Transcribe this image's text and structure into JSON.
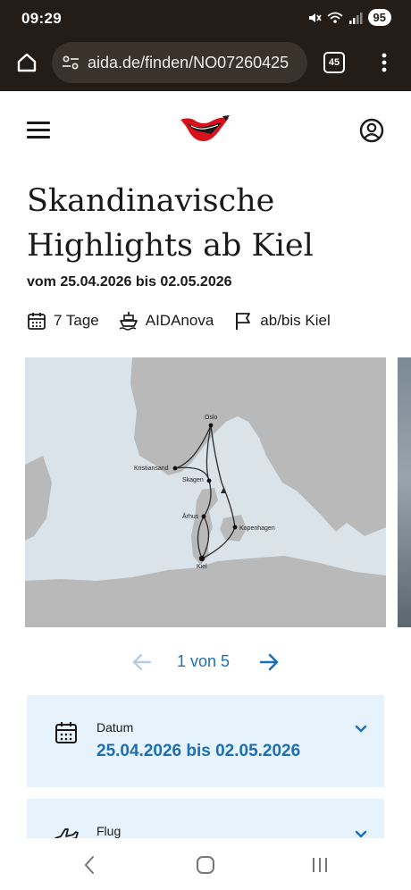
{
  "status_bar": {
    "time": "09:29",
    "battery": "95",
    "icons": [
      "mute-icon",
      "wifi-icon",
      "signal-icon"
    ]
  },
  "browser": {
    "url": "aida.de/finden/NO0726042​5",
    "tab_count": "45",
    "icons": [
      "home-icon",
      "site-settings-icon",
      "tabs-icon",
      "more-vert-icon"
    ]
  },
  "header": {
    "icons": [
      "menu-icon",
      "aida-logo-icon",
      "account-icon"
    ],
    "colors": {
      "logo_red": "#d8121b"
    }
  },
  "trip": {
    "title_line1": "Skandinavische",
    "title_line2": "Highlights ab Kiel",
    "date_range": "vom 25.04.2026 bis 02.05.2026",
    "duration": "7 Tage",
    "ship": "AIDAnova",
    "port": "ab/bis Kiel"
  },
  "map": {
    "ports": [
      "Oslo",
      "Kristiansand",
      "Skagen",
      "Århus",
      "Kopenhagen",
      "Kiel"
    ],
    "colors": {
      "water": "#dbe3ea",
      "land": "#b9b9b9",
      "route": "#2b2b2b"
    }
  },
  "pager": {
    "label": "1 von 5",
    "current": 1,
    "total": 5
  },
  "details": [
    {
      "label": "Datum",
      "value": "25.04.2026 bis 02.05.2026",
      "icon": "calendar-icon"
    },
    {
      "label": "Flug",
      "value": "",
      "icon": "plane-icon"
    }
  ],
  "colors": {
    "accent": "#1d6fb5",
    "panel": "#e6f2fc",
    "chrome": "#231c17"
  }
}
